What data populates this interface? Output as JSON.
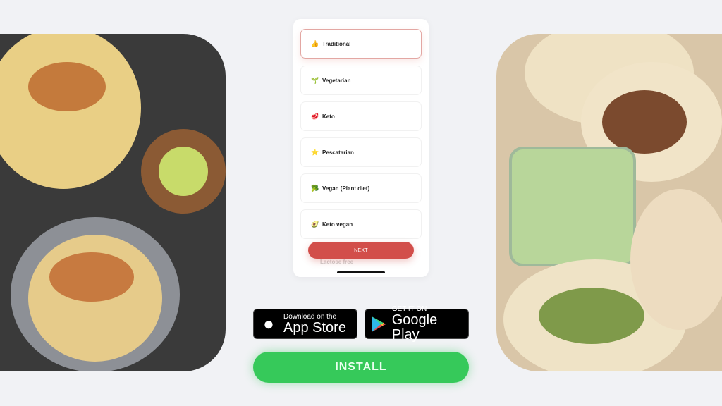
{
  "diet_options": [
    {
      "icon": "thumbs-up-icon",
      "glyph": "👍",
      "label": "Traditional",
      "selected": true
    },
    {
      "icon": "seedling-icon",
      "glyph": "🌱",
      "label": "Vegetarian",
      "selected": false
    },
    {
      "icon": "meat-icon",
      "glyph": "🥩",
      "label": "Keto",
      "selected": false
    },
    {
      "icon": "fish-icon",
      "glyph": "⭐",
      "label": "Pescatarian",
      "selected": false
    },
    {
      "icon": "broccoli-icon",
      "glyph": "🥦",
      "label": "Vegan (Plant diet)",
      "selected": false
    },
    {
      "icon": "avocado-icon",
      "glyph": "🥑",
      "label": "Keto vegan",
      "selected": false
    }
  ],
  "partial_option": "Lactose free",
  "next_label": "NEXT",
  "app_store": {
    "small": "Download on the",
    "big": "App Store"
  },
  "google_play": {
    "small": "GET IT ON",
    "big": "Google Play"
  },
  "install_label": "INSTALL",
  "colors": {
    "accent": "#d24e4a",
    "install": "#36c95a"
  }
}
